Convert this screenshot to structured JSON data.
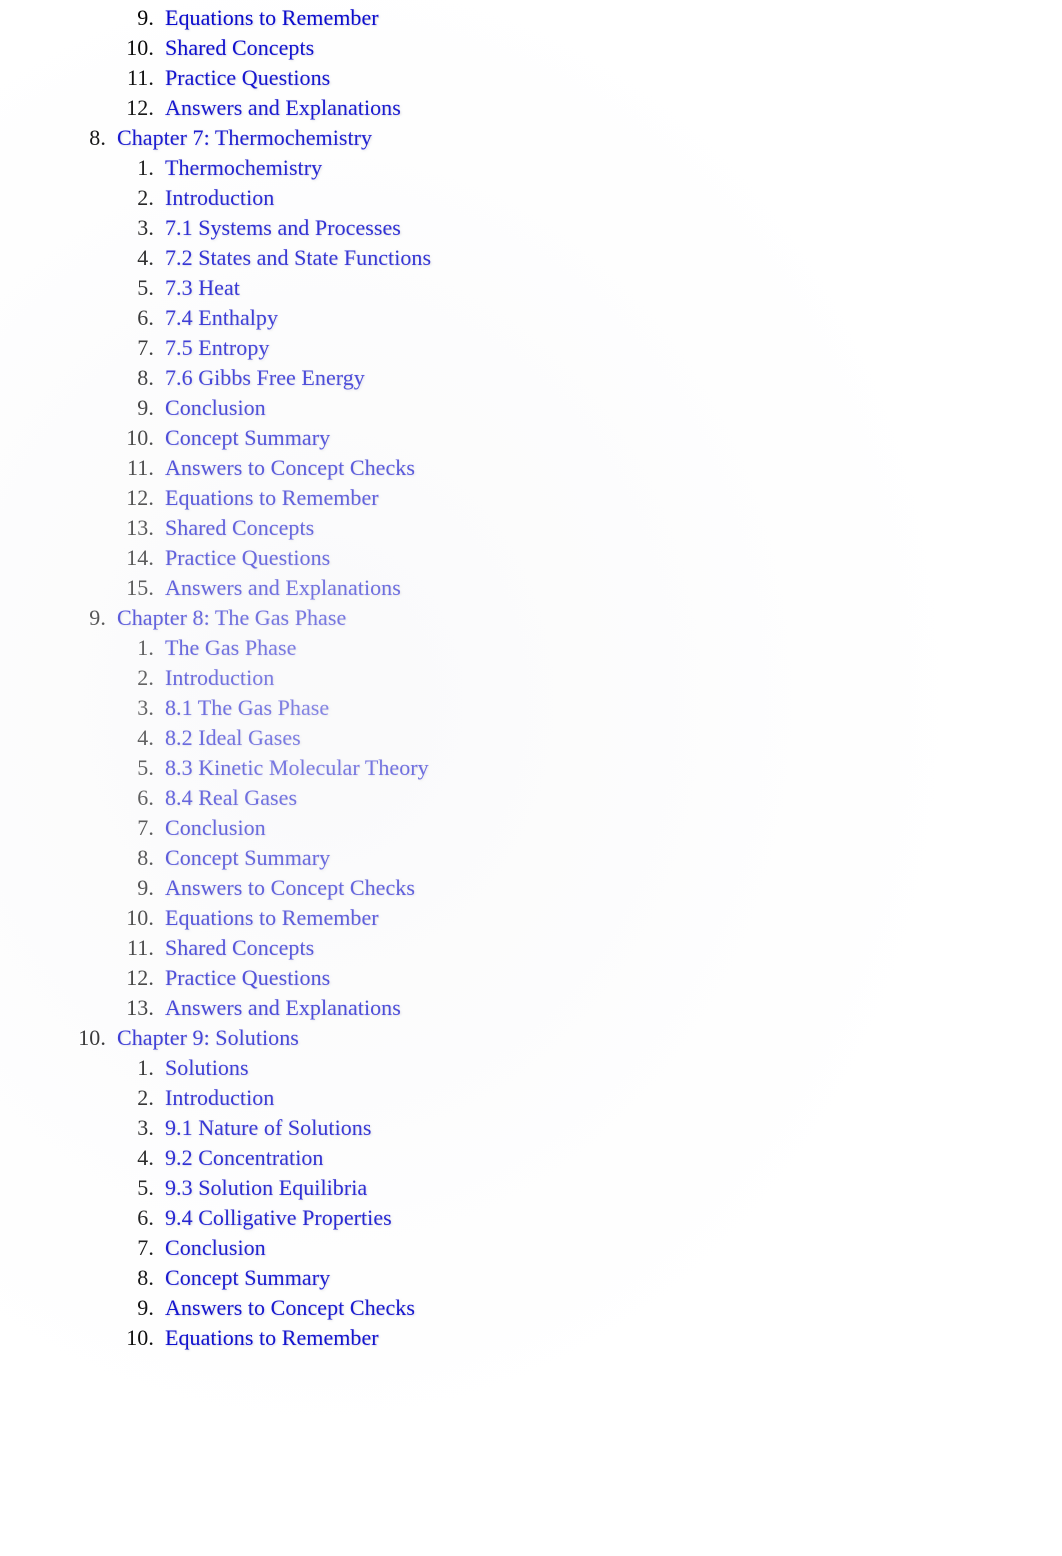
{
  "document": {
    "kind": "table-of-contents",
    "colors": {
      "link": "#0000cc",
      "number": "#000000",
      "page_background": "#ffffff"
    }
  },
  "toc": {
    "entries": [
      {
        "level": 2,
        "number": "9.",
        "label": "Equations to Remember"
      },
      {
        "level": 2,
        "number": "10.",
        "label": "Shared Concepts"
      },
      {
        "level": 2,
        "number": "11.",
        "label": "Practice Questions"
      },
      {
        "level": 2,
        "number": "12.",
        "label": "Answers and Explanations"
      },
      {
        "level": 1,
        "number": "8.",
        "label": "Chapter 7: Thermochemistry"
      },
      {
        "level": 2,
        "number": "1.",
        "label": "Thermochemistry"
      },
      {
        "level": 2,
        "number": "2.",
        "label": "Introduction"
      },
      {
        "level": 2,
        "number": "3.",
        "label": "7.1 Systems and Processes"
      },
      {
        "level": 2,
        "number": "4.",
        "label": "7.2 States and State Functions"
      },
      {
        "level": 2,
        "number": "5.",
        "label": "7.3 Heat"
      },
      {
        "level": 2,
        "number": "6.",
        "label": "7.4 Enthalpy"
      },
      {
        "level": 2,
        "number": "7.",
        "label": "7.5 Entropy"
      },
      {
        "level": 2,
        "number": "8.",
        "label": "7.6 Gibbs Free Energy"
      },
      {
        "level": 2,
        "number": "9.",
        "label": "Conclusion"
      },
      {
        "level": 2,
        "number": "10.",
        "label": "Concept Summary"
      },
      {
        "level": 2,
        "number": "11.",
        "label": "Answers to Concept Checks"
      },
      {
        "level": 2,
        "number": "12.",
        "label": "Equations to Remember"
      },
      {
        "level": 2,
        "number": "13.",
        "label": "Shared Concepts"
      },
      {
        "level": 2,
        "number": "14.",
        "label": "Practice Questions"
      },
      {
        "level": 2,
        "number": "15.",
        "label": "Answers and Explanations"
      },
      {
        "level": 1,
        "number": "9.",
        "label": "Chapter 8: The Gas Phase"
      },
      {
        "level": 2,
        "number": "1.",
        "label": "The Gas Phase"
      },
      {
        "level": 2,
        "number": "2.",
        "label": "Introduction"
      },
      {
        "level": 2,
        "number": "3.",
        "label": "8.1 The Gas Phase"
      },
      {
        "level": 2,
        "number": "4.",
        "label": "8.2 Ideal Gases"
      },
      {
        "level": 2,
        "number": "5.",
        "label": "8.3 Kinetic Molecular Theory"
      },
      {
        "level": 2,
        "number": "6.",
        "label": "8.4 Real Gases"
      },
      {
        "level": 2,
        "number": "7.",
        "label": "Conclusion"
      },
      {
        "level": 2,
        "number": "8.",
        "label": "Concept Summary"
      },
      {
        "level": 2,
        "number": "9.",
        "label": "Answers to Concept Checks"
      },
      {
        "level": 2,
        "number": "10.",
        "label": "Equations to Remember"
      },
      {
        "level": 2,
        "number": "11.",
        "label": "Shared Concepts"
      },
      {
        "level": 2,
        "number": "12.",
        "label": "Practice Questions"
      },
      {
        "level": 2,
        "number": "13.",
        "label": "Answers and Explanations"
      },
      {
        "level": 1,
        "number": "10.",
        "label": "Chapter 9: Solutions"
      },
      {
        "level": 2,
        "number": "1.",
        "label": "Solutions"
      },
      {
        "level": 2,
        "number": "2.",
        "label": "Introduction"
      },
      {
        "level": 2,
        "number": "3.",
        "label": "9.1 Nature of Solutions"
      },
      {
        "level": 2,
        "number": "4.",
        "label": "9.2 Concentration"
      },
      {
        "level": 2,
        "number": "5.",
        "label": "9.3 Solution Equilibria"
      },
      {
        "level": 2,
        "number": "6.",
        "label": "9.4 Colligative Properties"
      },
      {
        "level": 2,
        "number": "7.",
        "label": "Conclusion"
      },
      {
        "level": 2,
        "number": "8.",
        "label": "Concept Summary"
      },
      {
        "level": 2,
        "number": "9.",
        "label": "Answers to Concept Checks"
      },
      {
        "level": 2,
        "number": "10.",
        "label": "Equations to Remember"
      }
    ]
  }
}
